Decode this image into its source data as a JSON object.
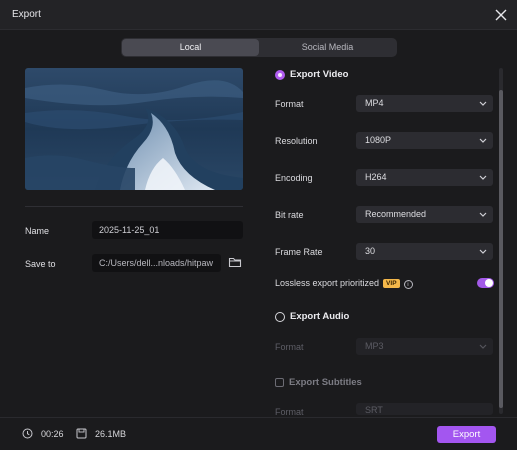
{
  "window": {
    "title": "Export"
  },
  "tabs": [
    {
      "label": "Local",
      "active": true
    },
    {
      "label": "Social Media",
      "active": false
    }
  ],
  "left": {
    "name_label": "Name",
    "name_value": "2025-11-25_01",
    "saveto_label": "Save to",
    "saveto_value": "C:/Users/dell...nloads/hitpaw"
  },
  "video": {
    "header": "Export Video",
    "format_label": "Format",
    "format_value": "MP4",
    "resolution_label": "Resolution",
    "resolution_value": "1080P",
    "encoding_label": "Encoding",
    "encoding_value": "H264",
    "bitrate_label": "Bit rate",
    "bitrate_value": "Recommended",
    "framerate_label": "Frame Rate",
    "framerate_value": "30",
    "lossless_label": "Lossless export prioritized",
    "vip_badge": "VIP",
    "lossless_enabled": true
  },
  "audio": {
    "header": "Export Audio",
    "format_label": "Format",
    "format_value": "MP3"
  },
  "subtitles": {
    "header": "Export Subtitles",
    "format_label": "Format",
    "format_value": "SRT"
  },
  "footer": {
    "duration": "00:26",
    "size": "26.1MB",
    "export_label": "Export"
  },
  "colors": {
    "accent": "#a356f0",
    "vip": "#f3b74a"
  }
}
